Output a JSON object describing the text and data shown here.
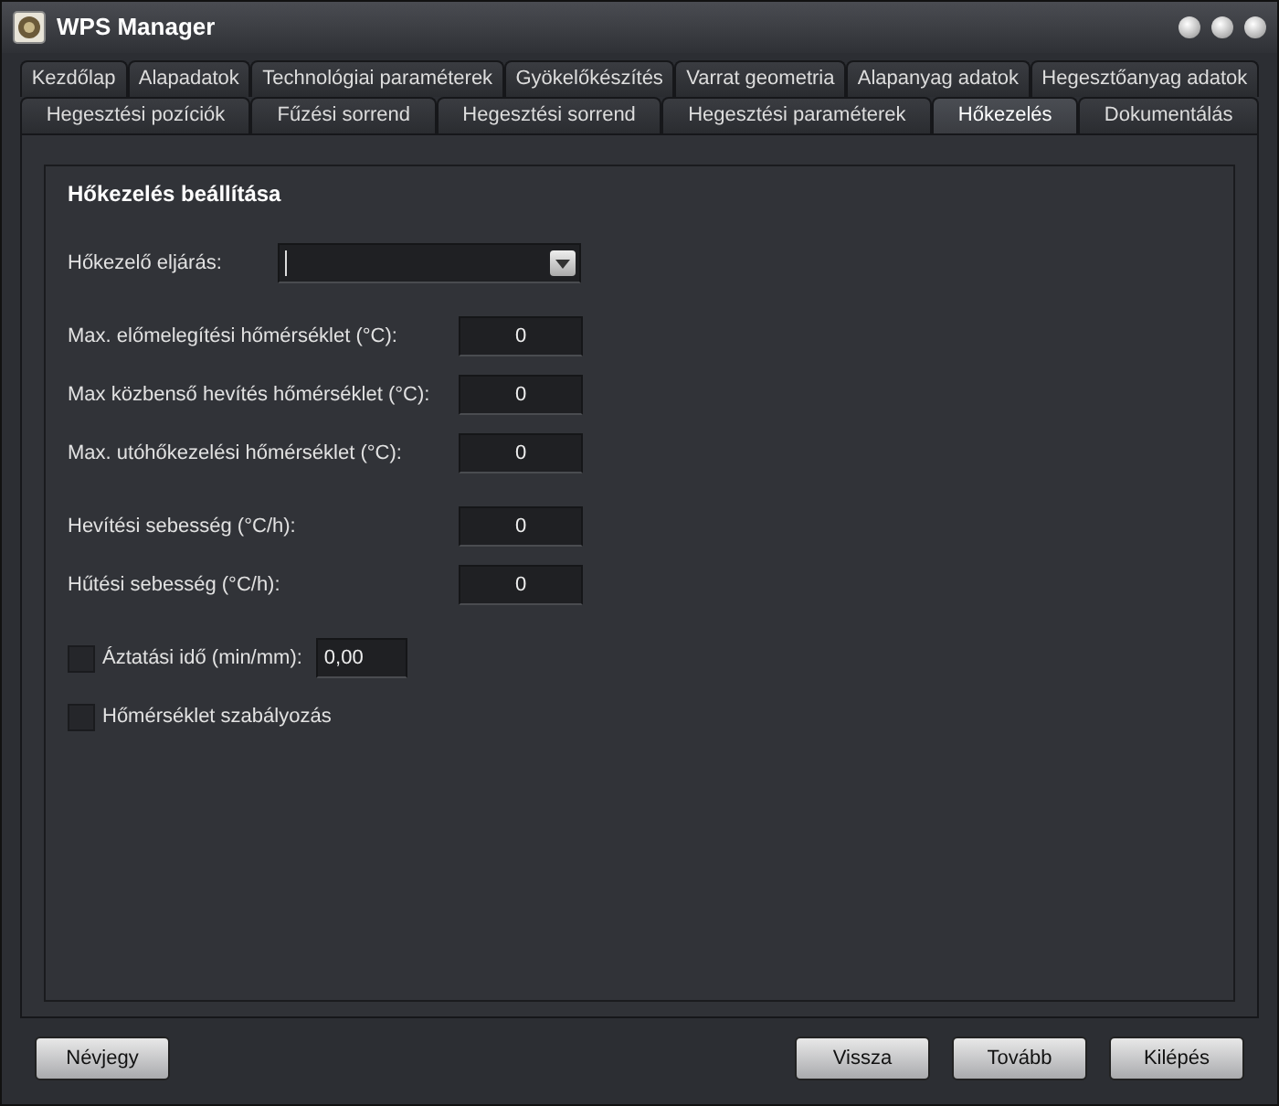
{
  "window": {
    "title": "WPS Manager"
  },
  "tab_rows": [
    [
      {
        "label": "Kezdőlap",
        "selected": false
      },
      {
        "label": "Alapadatok",
        "selected": false
      },
      {
        "label": "Technológiai paraméterek",
        "selected": false
      },
      {
        "label": "Gyökelőkészítés",
        "selected": false
      },
      {
        "label": "Varrat geometria",
        "selected": false
      },
      {
        "label": "Alapanyag adatok",
        "selected": false
      },
      {
        "label": "Hegesztőanyag adatok",
        "selected": false
      }
    ],
    [
      {
        "label": "Hegesztési pozíciók",
        "selected": false
      },
      {
        "label": "Fűzési sorrend",
        "selected": false
      },
      {
        "label": "Hegesztési sorrend",
        "selected": false
      },
      {
        "label": "Hegesztési paraméterek",
        "selected": false
      },
      {
        "label": "Hőkezelés",
        "selected": true
      },
      {
        "label": "Dokumentálás",
        "selected": false
      }
    ]
  ],
  "panel": {
    "title": "Hőkezelés beállítása",
    "groups": [
      [
        {
          "kind": "select",
          "label": "Hőkezelő eljárás:"
        }
      ],
      [
        {
          "kind": "number",
          "label": "Max. előmelegítési hőmérséklet (°C):",
          "value": "0"
        },
        {
          "kind": "number",
          "label": "Max közbenső hevítés hőmérséklet (°C):",
          "value": "0"
        },
        {
          "kind": "number",
          "label": "Max. utóhőkezelési hőmérséklet (°C):",
          "value": "0"
        }
      ],
      [
        {
          "kind": "number",
          "label": "Hevítési sebesség (°C/h):",
          "value": "0"
        },
        {
          "kind": "number",
          "label": "Hűtési sebesség (°C/h):",
          "value": "0"
        }
      ],
      [
        {
          "kind": "check-number",
          "label": "Áztatási idő (min/mm):",
          "value": "0,00",
          "checked": false
        },
        {
          "kind": "check",
          "label": "Hőmérséklet szabályozás",
          "checked": false
        }
      ]
    ]
  },
  "footer": {
    "left": [
      "Névjegy"
    ],
    "right": [
      "Vissza",
      "Tovább",
      "Kilépés"
    ]
  }
}
